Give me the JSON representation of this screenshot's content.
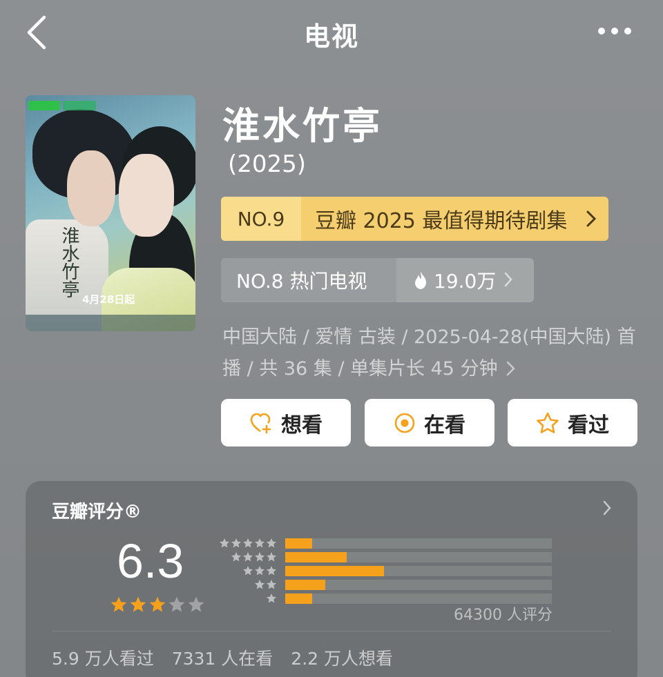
{
  "header": {
    "title": "电视",
    "back_icon": "chevron-left-icon",
    "more_icon": "more-dots-icon"
  },
  "show": {
    "title": "淮水竹亭",
    "year": "(2025)",
    "poster": {
      "calligraphy": "淮水竹亭",
      "date_text": "4月28日起"
    }
  },
  "rankings": {
    "primary": {
      "no": "NO.9",
      "label": "豆瓣 2025 最值得期待剧集",
      "chevron": "›"
    },
    "secondary": {
      "label": "NO.8 热门电视",
      "heat": "19.0万"
    }
  },
  "meta_text": "中国大陆 / 爱情 古装 / 2025-04-28(中国大陆) 首播 / 共 36 集 / 单集片长 45 分钟",
  "actions": {
    "want": "想看",
    "watching": "在看",
    "watched": "看过"
  },
  "rating": {
    "title": "豆瓣评分®",
    "score": "6.3",
    "score_stars": 3,
    "distribution": [
      {
        "stars": 5,
        "fraction": 0.1
      },
      {
        "stars": 4,
        "fraction": 0.23
      },
      {
        "stars": 3,
        "fraction": 0.37
      },
      {
        "stars": 2,
        "fraction": 0.15
      },
      {
        "stars": 1,
        "fraction": 0.1
      }
    ],
    "count": "64300 人评分",
    "stats": {
      "watched": "5.9 万人看过",
      "watching": "7331 人在看",
      "want": "2.2 万人想看"
    }
  },
  "colors": {
    "accent_orange": "#f5a11b",
    "rank_gold": "#f5cf6f",
    "background": "#8a8d90"
  }
}
